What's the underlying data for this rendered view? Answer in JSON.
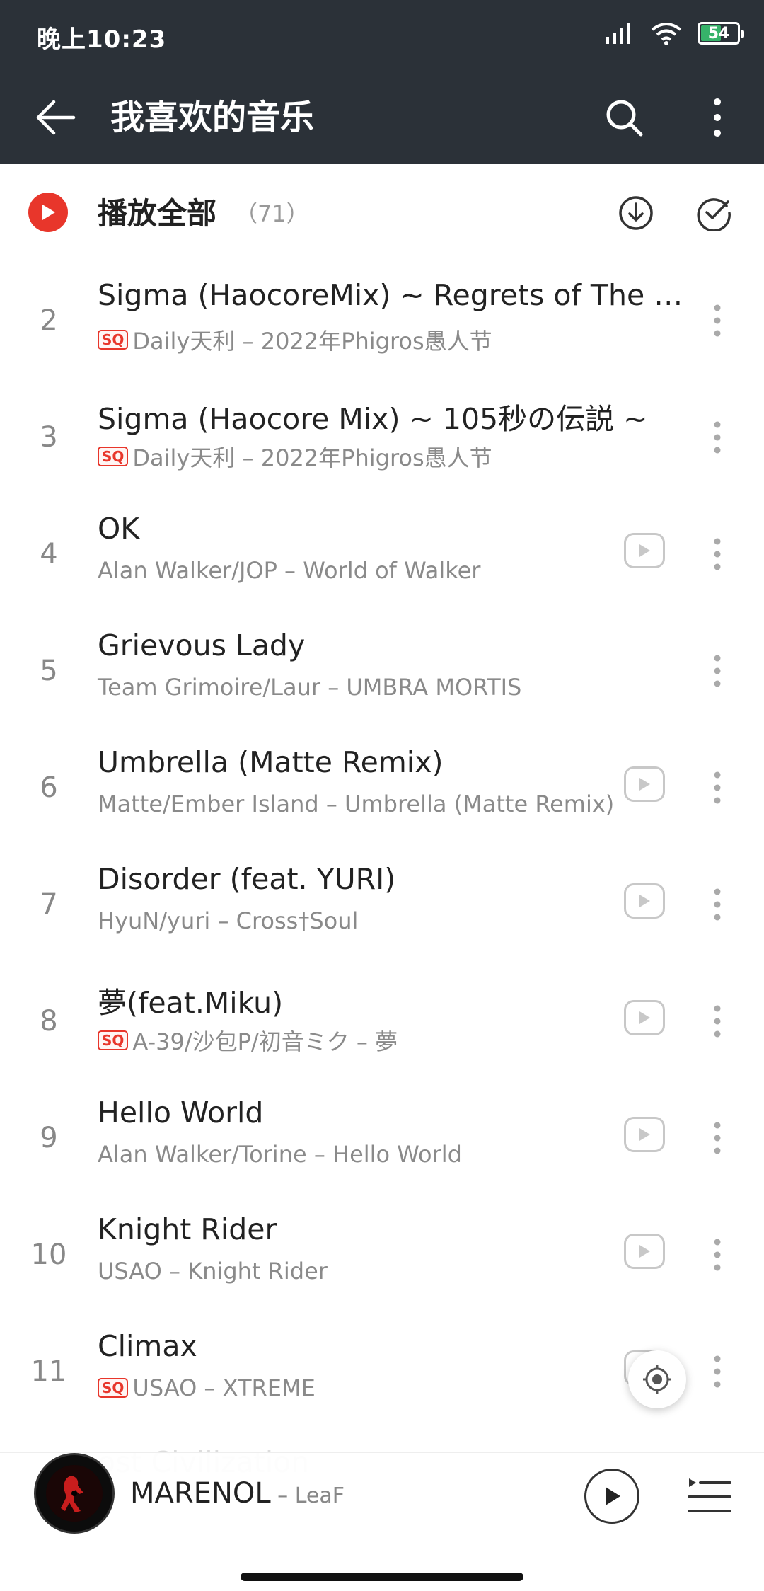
{
  "status_bar": {
    "time": "晚上10:23",
    "battery": "54",
    "battery_level": 0.54
  },
  "header": {
    "title": "我喜欢的音乐",
    "back_icon": "arrow-left-icon",
    "search_icon": "search-icon",
    "more_icon": "more-vertical-icon"
  },
  "play_all": {
    "label": "播放全部",
    "count": "（71）",
    "download_icon": "download-icon",
    "select_icon": "check-circle-icon"
  },
  "songs": [
    {
      "index": "2",
      "title": "Sigma (HaocoreMix) ~ Regrets of The Ye…",
      "sq": true,
      "subtitle": "Daily天利 – 2022年Phigros愚人节",
      "mv": false
    },
    {
      "index": "3",
      "title": "Sigma (Haocore Mix) ~ 105秒の伝説 ~",
      "sq": true,
      "subtitle": "Daily天利 – 2022年Phigros愚人节",
      "mv": false
    },
    {
      "index": "4",
      "title": "OK",
      "sq": false,
      "subtitle": "Alan Walker/JOP – World of Walker",
      "mv": true
    },
    {
      "index": "5",
      "title": "Grievous Lady",
      "sq": false,
      "subtitle": "Team Grimoire/Laur – UMBRA MORTIS",
      "mv": false
    },
    {
      "index": "6",
      "title": "Umbrella (Matte Remix)",
      "sq": false,
      "subtitle": "Matte/Ember Island – Umbrella (Matte Remix)",
      "mv": true
    },
    {
      "index": "7",
      "title": "Disorder (feat. YURI)",
      "sq": false,
      "subtitle": "HyuN/yuri – Cross†Soul",
      "mv": true
    },
    {
      "index": "8",
      "title": "夢(feat.Miku)",
      "sq": true,
      "subtitle": "A-39/沙包P/初音ミク – 夢",
      "mv": true
    },
    {
      "index": "9",
      "title": "Hello World",
      "sq": false,
      "subtitle": "Alan Walker/Torine – Hello World",
      "mv": true
    },
    {
      "index": "10",
      "title": "Knight Rider",
      "sq": false,
      "subtitle": "USAO – Knight Rider",
      "mv": true
    },
    {
      "index": "11",
      "title": "Climax",
      "sq": true,
      "subtitle": "USAO – XTREME",
      "mv": true
    }
  ],
  "sq_badge": "SQ",
  "ghost_title": "ost Civilization",
  "player": {
    "title": "MARENOL",
    "separator": " – ",
    "artist": "LeaF",
    "play_icon": "play-icon",
    "queue_icon": "playlist-icon"
  },
  "colors": {
    "header_bg": "#2b3138",
    "accent": "#e8362b",
    "text_primary": "#222222",
    "text_secondary": "#8a8a8a"
  }
}
